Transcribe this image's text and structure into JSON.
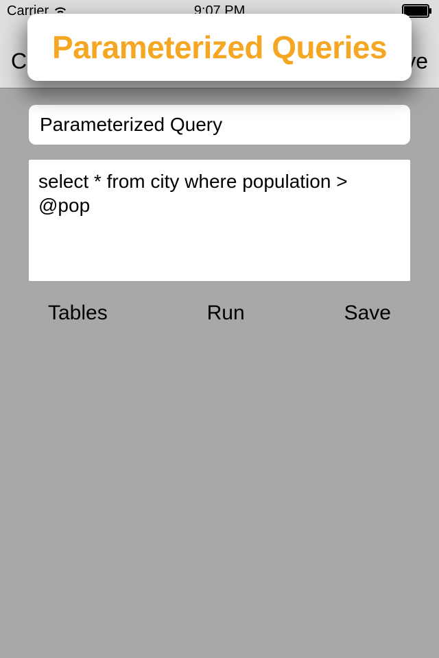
{
  "status": {
    "carrier": "Carrier",
    "time": "9:07 PM"
  },
  "nav": {
    "left_partial": "C",
    "right_partial": "ve"
  },
  "overlay": {
    "title": "Parameterized Queries"
  },
  "query": {
    "name_value": "Parameterized Query",
    "sql_value": "select * from city where population > @pop"
  },
  "actions": {
    "tables": "Tables",
    "run": "Run",
    "save": "Save"
  }
}
